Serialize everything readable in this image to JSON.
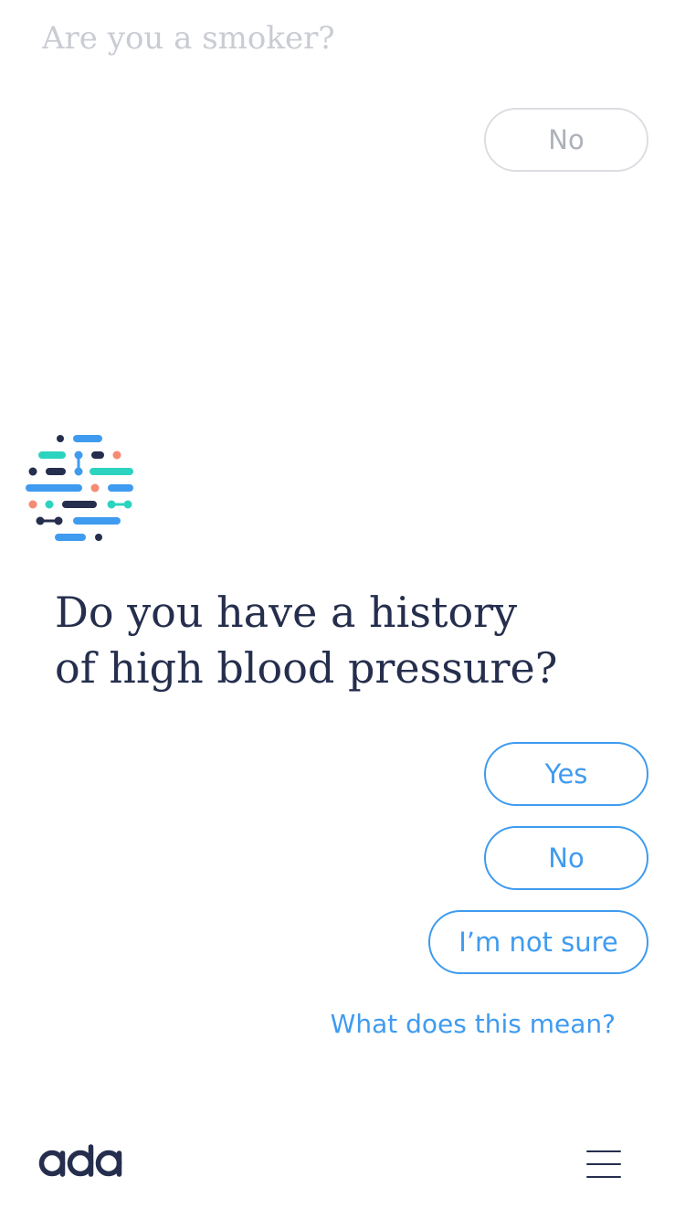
{
  "history": {
    "previous_question": "Are you a smoker?",
    "previous_answer": "No"
  },
  "current": {
    "question_line1": "Do you have a history",
    "question_line2": "of high blood pressure?",
    "answers": {
      "yes": "Yes",
      "no": "No",
      "unsure": "I’m not sure"
    },
    "help_link": "What does this mean?"
  },
  "footer": {
    "logo_text": "ada",
    "menu_icon": "hamburger-menu-icon"
  },
  "colors": {
    "primary_blue": "#3f9bef",
    "navy": "#252e4d",
    "teal": "#2cd4c0",
    "coral": "#f58b72",
    "muted_text": "#c9ccd3",
    "muted_border": "#dcdee3"
  }
}
